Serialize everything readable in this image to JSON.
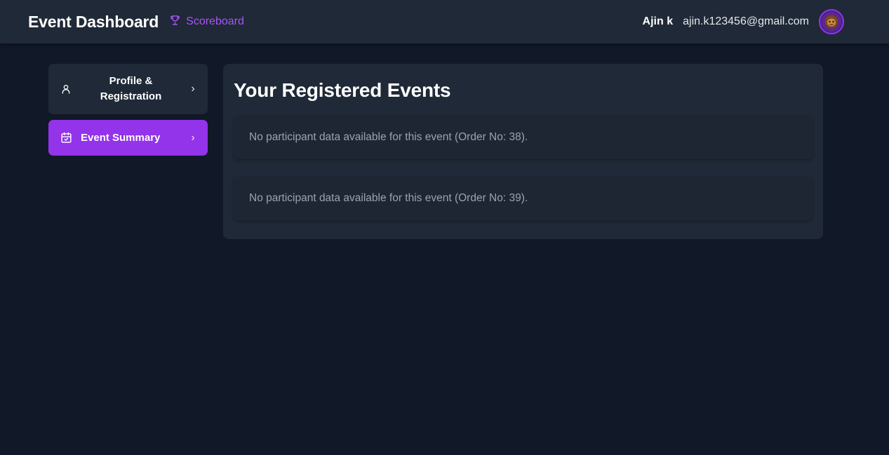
{
  "header": {
    "title": "Event Dashboard",
    "scoreboard_label": "Scoreboard",
    "scoreboard_icon": "trophy-icon",
    "user_name": "Ajin k",
    "user_email": "ajin.k123456@gmail.com",
    "avatar_icon": "user-avatar"
  },
  "sidebar": {
    "items": [
      {
        "label": "Profile & Registration",
        "icon": "user-icon",
        "active": false
      },
      {
        "label": "Event Summary",
        "icon": "calendar-check-icon",
        "active": true
      }
    ],
    "chevron": "›"
  },
  "main": {
    "title": "Your Registered Events",
    "events": [
      {
        "message": "No participant data available for this event (Order No: 38)."
      },
      {
        "message": "No participant data available for this event (Order No: 39)."
      }
    ]
  },
  "colors": {
    "background": "#111827",
    "surface": "#1f2937",
    "accent": "#9333ea",
    "accent_text": "#a855f7",
    "muted_text": "#9ca3af"
  }
}
